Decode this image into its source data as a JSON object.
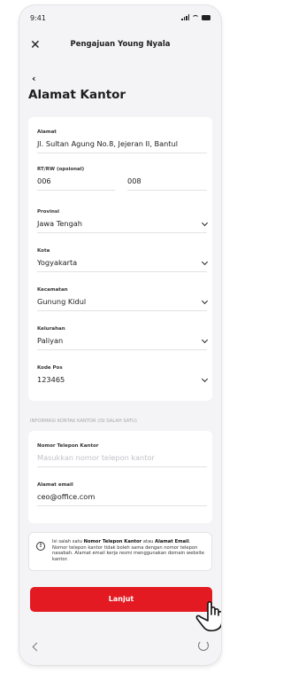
{
  "status": {
    "time": "9:41"
  },
  "header": {
    "title": "Pengajuan Young Nyala",
    "close_icon": "close-icon",
    "back_icon": "chevron-left-icon"
  },
  "page_title": "Alamat Kantor",
  "address_form": {
    "alamat": {
      "label": "Alamat",
      "value": "Jl. Sultan Agung No.8, Jejeran II, Bantul"
    },
    "rtrw": {
      "label": "RT/RW (opsional)",
      "rt": "006",
      "rw": "008"
    },
    "provinsi": {
      "label": "Provinsi",
      "value": "Jawa Tengah"
    },
    "kota": {
      "label": "Kota",
      "value": "Yogyakarta"
    },
    "kecamatan": {
      "label": "Kecamatan",
      "value": "Gunung Kidul"
    },
    "kelurahan": {
      "label": "Kelurahan",
      "value": "Paliyan"
    },
    "kodepos": {
      "label": "Kode Pos",
      "value": "123465"
    }
  },
  "contact_section": {
    "heading": "INFORMASI KONTAK KANTOR (ISI SALAH SATU)",
    "phone": {
      "label": "Nomor Telepon Kantor",
      "placeholder": "Masukkan nomor telepon kantor",
      "value": ""
    },
    "email": {
      "label": "Alamat email",
      "value": "ceo@office.com"
    }
  },
  "info_box": {
    "text_prefix": "Isi salah satu ",
    "bold1": "Nomor Telepon Kantor",
    "text_mid": " atau ",
    "bold2": "Alamat Email",
    "text_end": ".",
    "note": "Nomor telepon kantor tidak boleh sama dengan nomor telepon nasabah. Alamat email kerja resmi menggunakan domain website kantor."
  },
  "cta": {
    "label": "Lanjut"
  },
  "colors": {
    "accent": "#e31a22",
    "background": "#f4f4f6"
  }
}
